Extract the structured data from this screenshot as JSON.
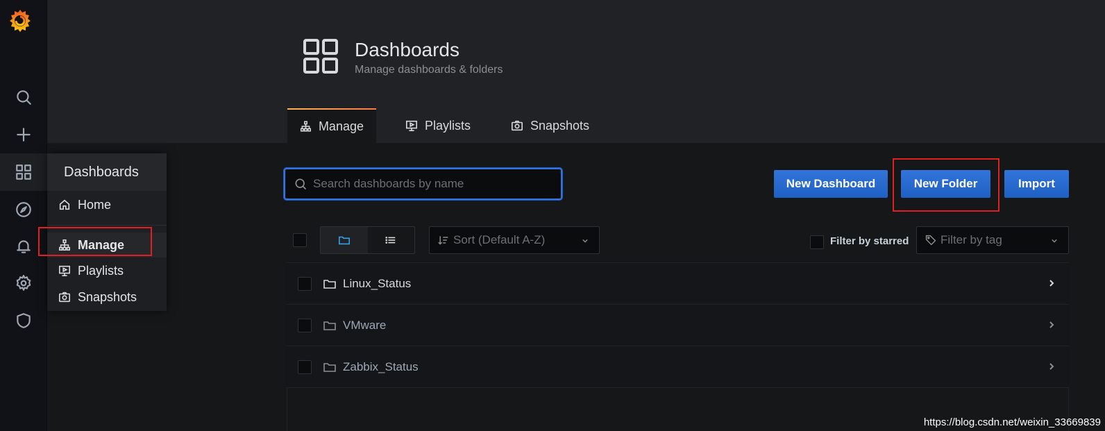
{
  "page": {
    "title": "Dashboards",
    "subtitle": "Manage dashboards & folders"
  },
  "sidemenu": {
    "icons": [
      "grafana-logo",
      "search-icon",
      "plus-icon",
      "dashboards-icon",
      "explore-icon",
      "alerting-icon",
      "configuration-icon",
      "shield-icon"
    ]
  },
  "submenu": {
    "title": "Dashboards",
    "items": [
      {
        "label": "Home",
        "icon": "home-icon"
      },
      {
        "label": "Manage",
        "icon": "sitemap-icon"
      },
      {
        "label": "Playlists",
        "icon": "presentation-icon"
      },
      {
        "label": "Snapshots",
        "icon": "camera-icon"
      }
    ]
  },
  "tabs": [
    {
      "label": "Manage",
      "icon": "sitemap-icon",
      "active": true
    },
    {
      "label": "Playlists",
      "icon": "presentation-icon",
      "active": false
    },
    {
      "label": "Snapshots",
      "icon": "camera-icon",
      "active": false
    }
  ],
  "search": {
    "placeholder": "Search dashboards by name",
    "value": ""
  },
  "actions": {
    "new_dashboard": "New Dashboard",
    "new_folder": "New Folder",
    "import": "Import"
  },
  "filters": {
    "sort_placeholder": "Sort (Default A-Z)",
    "starred_label": "Filter by starred",
    "tag_placeholder": "Filter by tag"
  },
  "folders": [
    {
      "name": "Linux_Status"
    },
    {
      "name": "VMware"
    },
    {
      "name": "Zabbix_Status"
    }
  ],
  "watermark": "https://blog.csdn.net/weixin_33669839",
  "colors": {
    "primary_button": "#3274d9",
    "tab_accent": "#ff7941",
    "highlight_box": "#e02020"
  }
}
